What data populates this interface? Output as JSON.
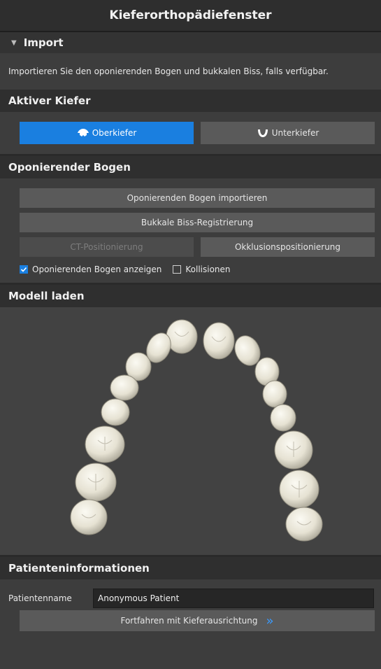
{
  "window": {
    "title": "Kieferorthopädiefenster"
  },
  "import": {
    "header": "Import",
    "description": "Importieren Sie den oponierenden Bogen und bukkalen Biss, falls verfügbar."
  },
  "active_jaw": {
    "header": "Aktiver Kiefer",
    "upper_label": "Oberkiefer",
    "lower_label": "Unterkiefer",
    "selected": "Oberkiefer",
    "accent_color": "#1a7fe0"
  },
  "opposing_arch": {
    "header": "Oponierender Bogen",
    "import_label": "Oponierenden Bogen importieren",
    "buccal_label": "Bukkale Biss-Registrierung",
    "ct_label": "CT-Positionierung",
    "occlusion_label": "Okklusionspositionierung",
    "show_arch_label": "Oponierenden Bogen anzeigen",
    "show_arch_checked": true,
    "collisions_label": "Kollisionen",
    "collisions_checked": false
  },
  "model": {
    "header": "Modell laden",
    "preview_icon": "dental-arch-icon"
  },
  "patient": {
    "header": "Patienteninformationen",
    "name_label": "Patientenname",
    "name_value": "Anonymous Patient",
    "continue_label": "Fortfahren mit Kieferausrichtung",
    "continue_icon": "double-chevron-right-icon"
  }
}
